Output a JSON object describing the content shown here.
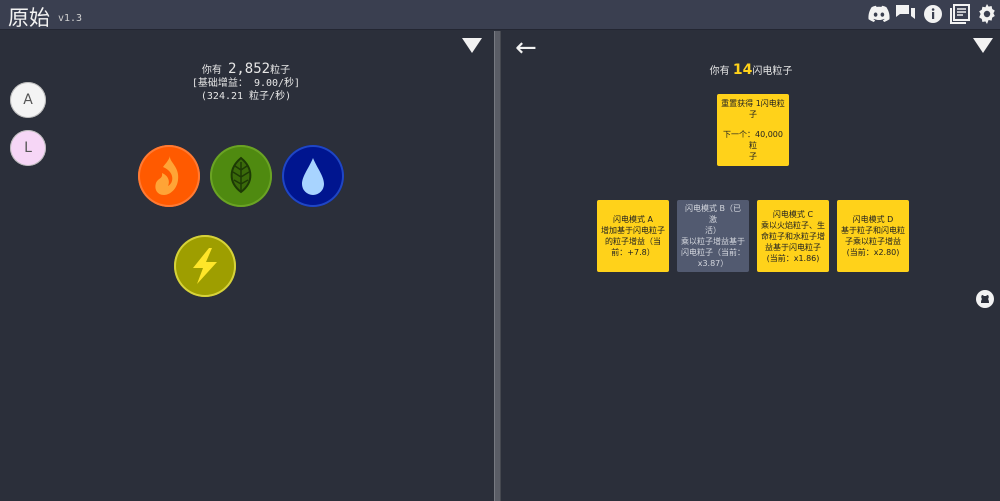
{
  "app": {
    "title": "原始",
    "version": "v1.3"
  },
  "left": {
    "line1_prefix": "你有",
    "line1_amount": "2,852",
    "line1_suffix": "粒子",
    "line2": "[基础增益： 9.00/秒]",
    "line3": "(324.21 粒子/秒)",
    "side_buttons": [
      {
        "label": "A"
      },
      {
        "label": "L"
      }
    ],
    "layers": [
      {
        "icon": "flame-icon",
        "color": "#ff5a00"
      },
      {
        "icon": "leaf-icon",
        "color": "#4f8a10"
      },
      {
        "icon": "water-drop-icon",
        "color": "#00158f"
      },
      {
        "icon": "lightning-icon",
        "color": "#9e9e00"
      }
    ]
  },
  "right": {
    "back": "←",
    "prefix": "你有",
    "amount": "14",
    "suffix": "闪电粒子",
    "reset": {
      "line1": "重置获得 1闪电粒",
      "line2": "子",
      "line3": "下一个：40,000粒",
      "line4": "子"
    },
    "cards": [
      {
        "l1": "闪电模式 A",
        "l2": "增加基于闪电粒子",
        "l3": "的粒子增益（当",
        "l4": "前：+7.8）"
      },
      {
        "l1": "闪电模式 B（已激",
        "l2": "活）",
        "l3": "乘以粒子增益基于",
        "l4": "闪电粒子（当前：",
        "l5": "x3.87）"
      },
      {
        "l1": "闪电模式 C",
        "l2": "乘以火焰粒子、生",
        "l3": "命粒子和水粒子增",
        "l4": "益基于闪电粒子",
        "l5": "(当前：x1.86)"
      },
      {
        "l1": "闪电模式 D",
        "l2": "基于粒子和闪电粒",
        "l3": "子乘以粒子增益",
        "l4": "(当前：x2.80)"
      }
    ]
  },
  "colors": {
    "accent": "#ffd21a",
    "panel_bg": "#2b2f3a",
    "topbar_bg": "#3a3f50",
    "card_disabled": "#525a70"
  }
}
